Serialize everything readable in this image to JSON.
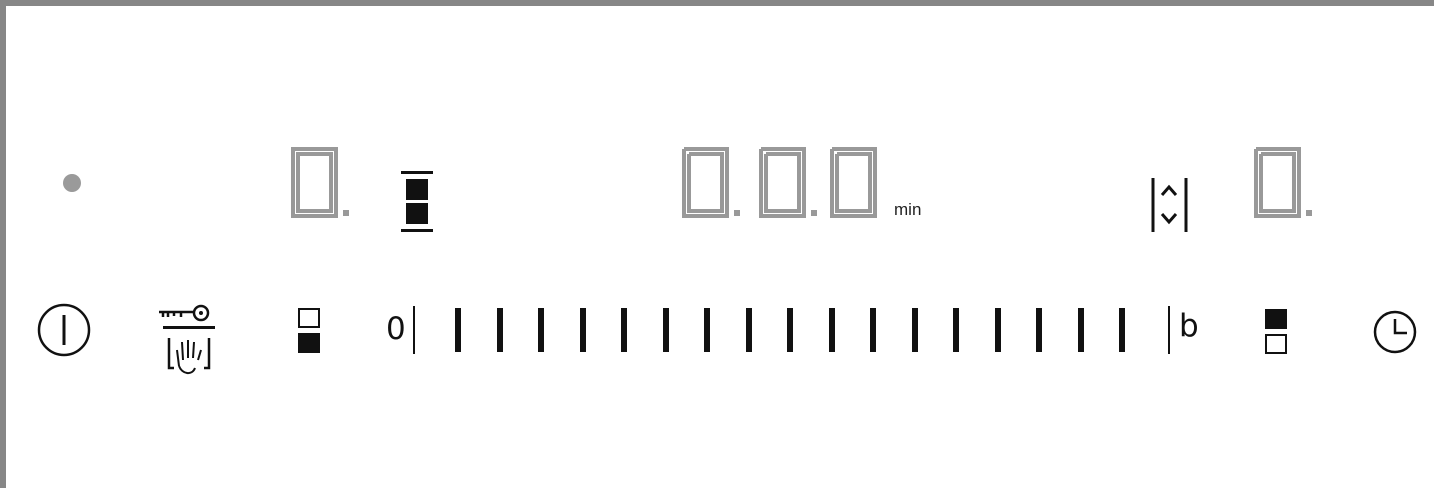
{
  "panel": {
    "status_light": "dot",
    "zone_display": {
      "digit": "0",
      "decimal": "."
    },
    "timer_display": {
      "digits": [
        "0",
        "0",
        "0"
      ],
      "unit": "min"
    },
    "right_display": {
      "digit": "0",
      "decimal": "."
    },
    "slider": {
      "min_label": "0",
      "max_label": "b",
      "steps": 17
    }
  },
  "icons": {
    "power": "power-icon",
    "lock": "key-lock-wipe-icon",
    "zone_select_left": "zone-select-lower-icon",
    "zone_select_right": "zone-select-upper-icon",
    "timer": "clock-icon",
    "zone_indicator": "zone-indicator-icon",
    "flex": "updown-arrows-icon"
  },
  "colors": {
    "frame": "#878787",
    "segment_off": "#999999",
    "foreground": "#111111"
  }
}
